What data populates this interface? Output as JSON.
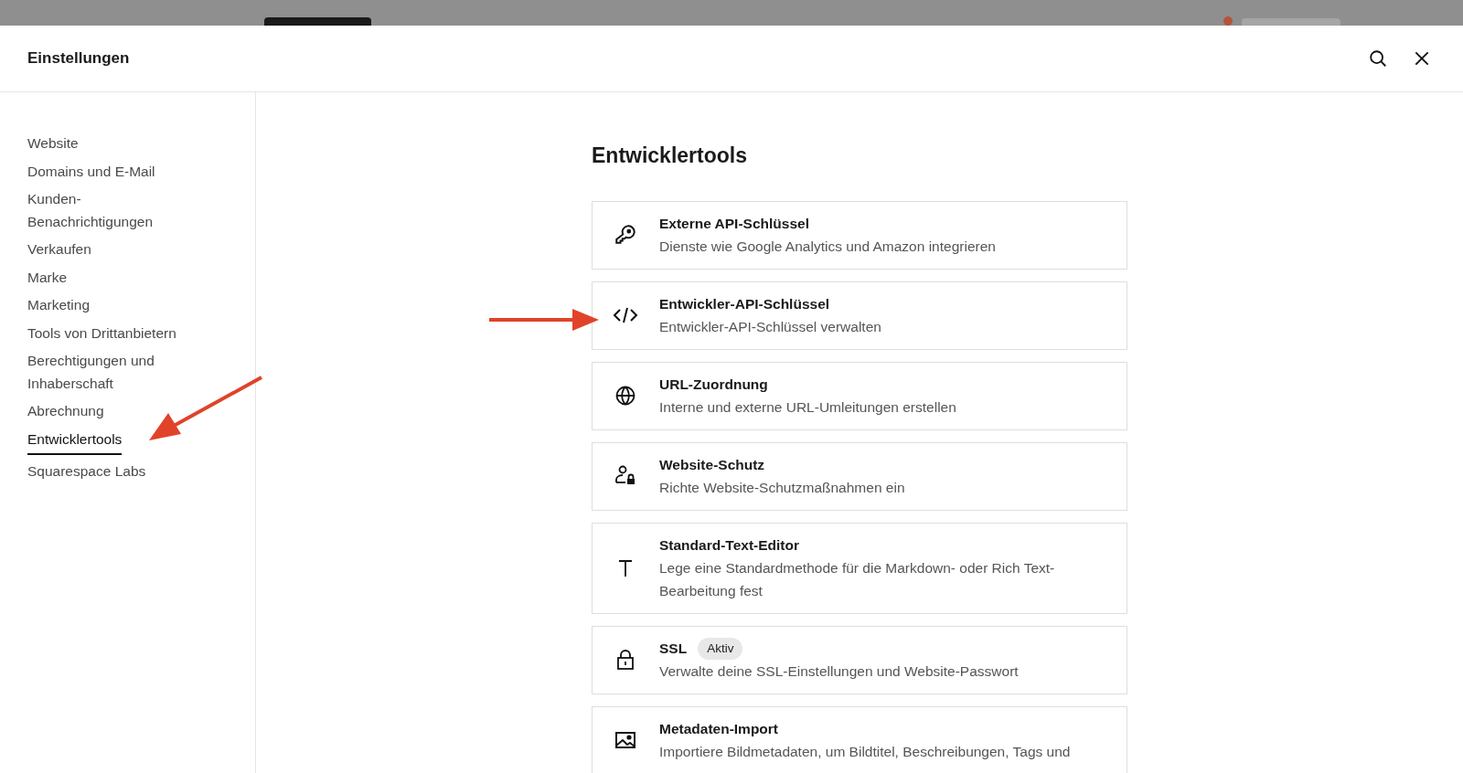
{
  "header": {
    "title": "Einstellungen"
  },
  "sidebar": {
    "items": [
      {
        "label": "Website",
        "selected": false
      },
      {
        "label": "Domains und E-Mail",
        "selected": false
      },
      {
        "label": "Kunden-\nBenachrichtigungen",
        "selected": false
      },
      {
        "label": "Verkaufen",
        "selected": false
      },
      {
        "label": "Marke",
        "selected": false
      },
      {
        "label": "Marketing",
        "selected": false
      },
      {
        "label": "Tools von Drittanbietern",
        "selected": false
      },
      {
        "label": "Berechtigungen und\nInhaberschaft",
        "selected": false
      },
      {
        "label": "Abrechnung",
        "selected": false
      },
      {
        "label": "Entwicklertools",
        "selected": true
      },
      {
        "label": "Squarespace Labs",
        "selected": false
      }
    ]
  },
  "main": {
    "heading": "Entwicklertools",
    "cards": [
      {
        "title": "Externe API-Schlüssel",
        "description": "Dienste wie Google Analytics und Amazon integrieren"
      },
      {
        "title": "Entwickler-API-Schlüssel",
        "description": "Entwickler-API-Schlüssel verwalten"
      },
      {
        "title": "URL-Zuordnung",
        "description": "Interne und externe URL-Umleitungen erstellen"
      },
      {
        "title": "Website-Schutz",
        "description": "Richte Website-Schutzmaßnahmen ein"
      },
      {
        "title": "Standard-Text-Editor",
        "description": "Lege eine Standardmethode für die Markdown- oder Rich Text-Bearbeitung fest"
      },
      {
        "title": "SSL",
        "badge": "Aktiv",
        "description": "Verwalte deine SSL-Einstellungen und Website-Passwort"
      },
      {
        "title": "Metadaten-Import",
        "description": "Importiere Bildmetadaten, um Bildtitel, Beschreibungen, Tags und"
      }
    ]
  }
}
